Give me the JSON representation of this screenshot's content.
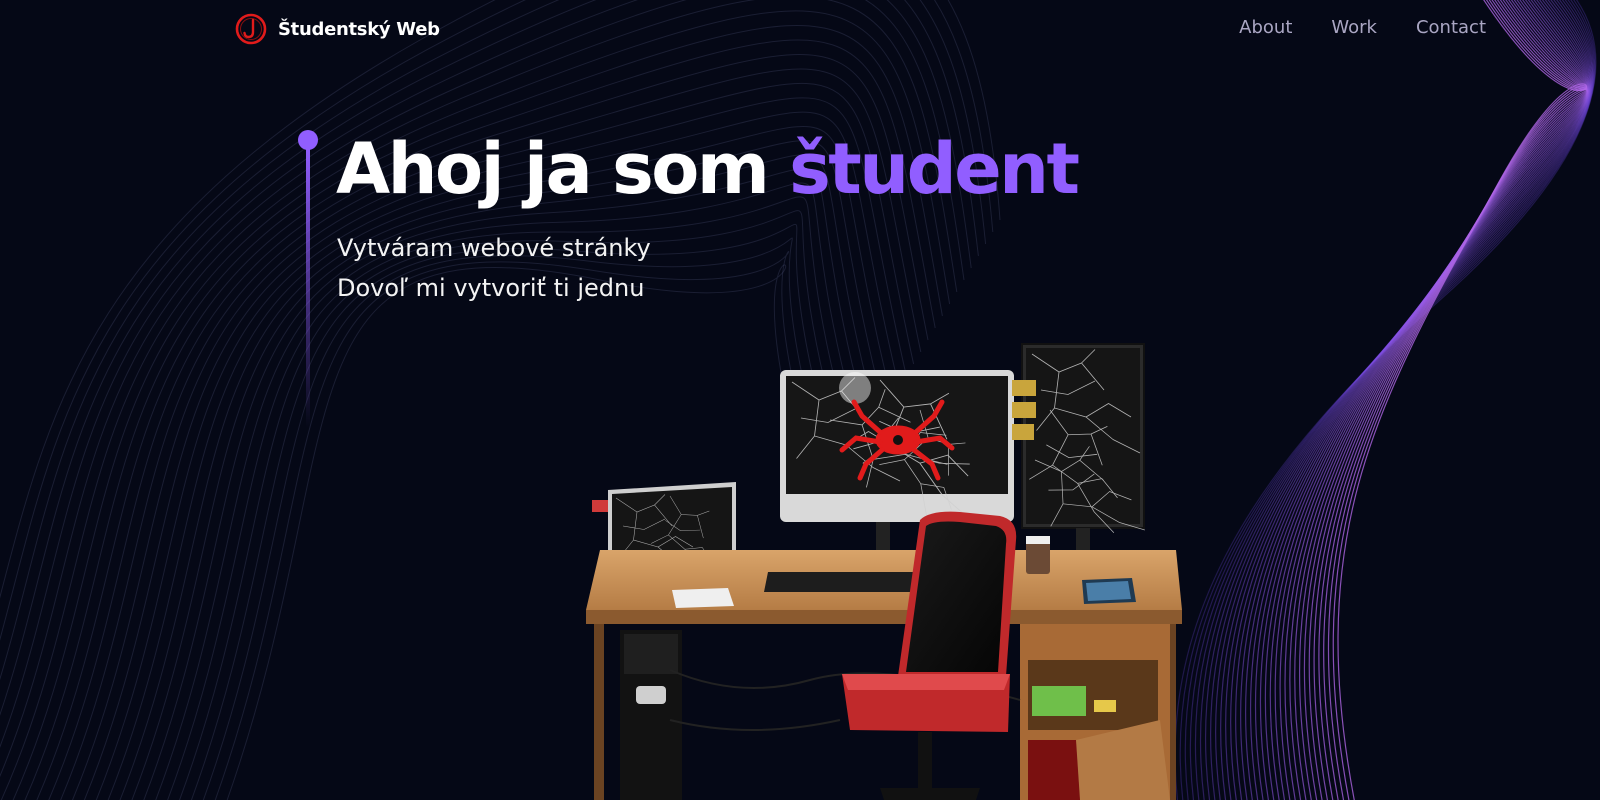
{
  "header": {
    "logo_letter": "J",
    "brand_name": "Študentský Web",
    "nav": [
      {
        "label": "About"
      },
      {
        "label": "Work"
      },
      {
        "label": "Contact"
      }
    ]
  },
  "hero": {
    "title_prefix": "Ahoj ja som ",
    "title_highlight": "študent",
    "subtitle_line1": "Vytváram webové stránky",
    "subtitle_line2": "Dovoľ mi vytvoriť ti jednu"
  },
  "colors": {
    "background": "#050816",
    "accent": "#915eff",
    "nav_link": "#aaa6c3",
    "logo_red": "#e11b1b"
  },
  "icons": {
    "logo": "circle-j-logo-icon"
  }
}
